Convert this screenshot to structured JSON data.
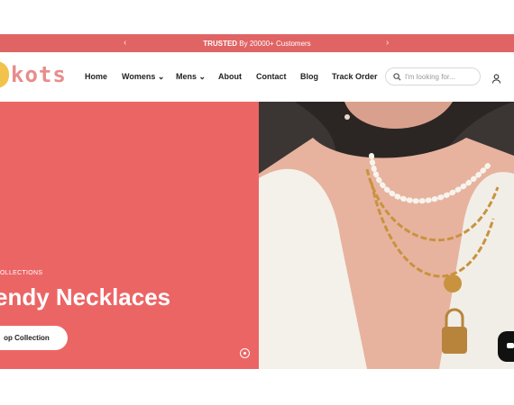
{
  "announcement": {
    "strong": "TRUSTED",
    "rest": " By 20000+ Customers",
    "prev_icon": "chevron-left-icon",
    "next_icon": "chevron-right-icon"
  },
  "brand": {
    "logo_text": "kots",
    "logo_color": "#e88c8c",
    "mark_color": "#f2c34a"
  },
  "nav": {
    "items": [
      {
        "label": "Home"
      },
      {
        "label": "Womens",
        "has_dropdown": true
      },
      {
        "label": "Mens",
        "has_dropdown": true
      },
      {
        "label": "About"
      },
      {
        "label": "Contact"
      },
      {
        "label": "Blog"
      },
      {
        "label": "Track Order"
      }
    ]
  },
  "search": {
    "placeholder": "I'm looking for..."
  },
  "hero": {
    "eyebrow": "OLLECTIONS",
    "title": "endy Necklaces",
    "cta": "op Collection",
    "background": "#ec6565"
  },
  "colors": {
    "announce_bg": "#e06464",
    "hero_bg": "#ec6565"
  }
}
